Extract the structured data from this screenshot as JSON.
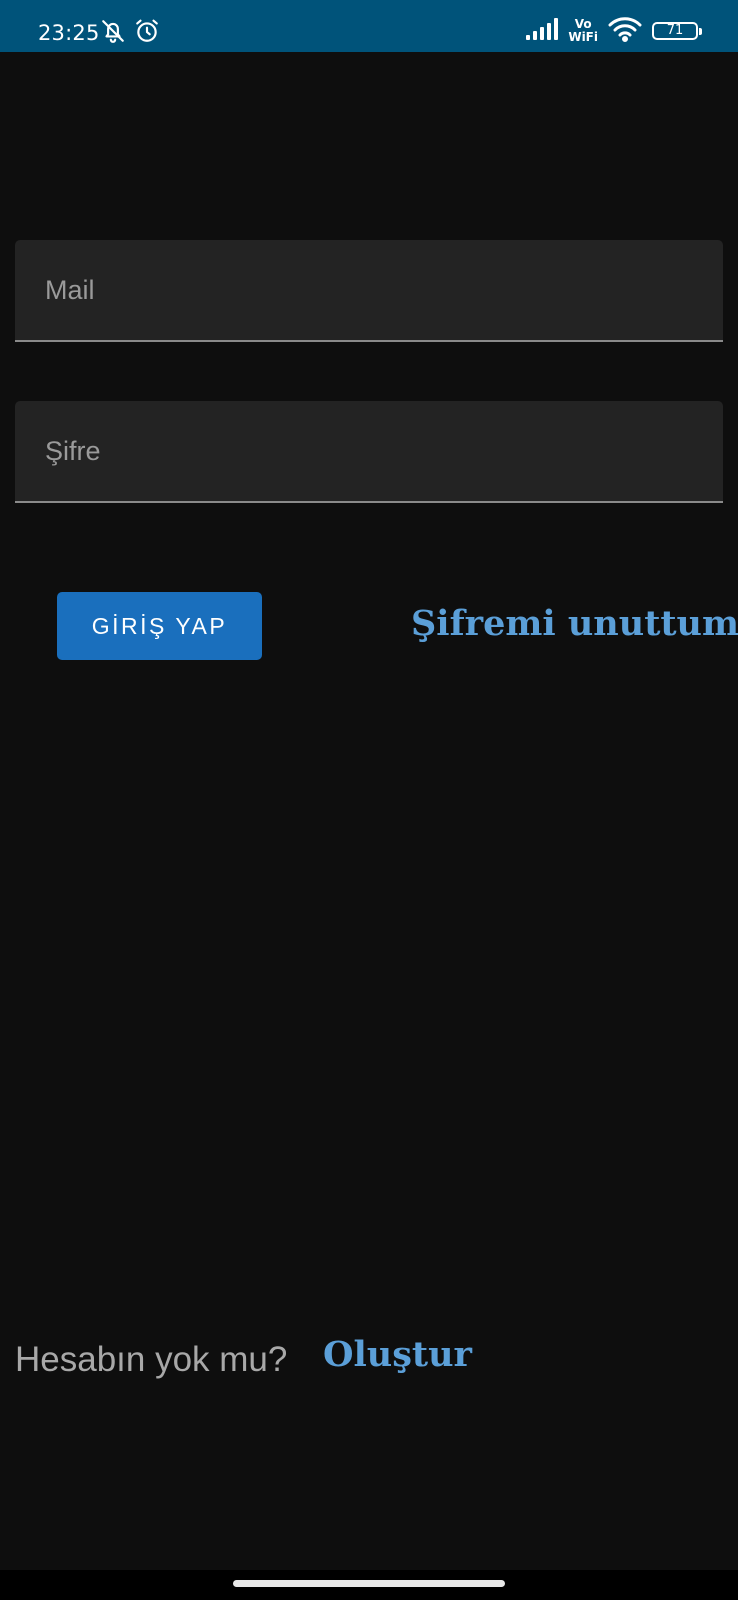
{
  "status_bar": {
    "time": "23:25",
    "left_icons": [
      "bell-off-icon",
      "alarm-icon"
    ],
    "network_label_top": "Vo",
    "network_label_bottom": "WiFi",
    "battery_level": "71",
    "background_color": "#00537a"
  },
  "login_form": {
    "mail_placeholder": "Mail",
    "mail_value": "",
    "password_placeholder": "Şifre",
    "password_value": "",
    "login_button_label": "GİRİŞ YAP",
    "forgot_password_label": "Şifremi unuttum"
  },
  "signup": {
    "prompt": "Hesabın yok mu?",
    "link_label": "Oluştur"
  },
  "colors": {
    "background": "#0e0e0e",
    "field_background": "#232323",
    "accent_button": "#1a6fbd",
    "link": "#5b9fd8"
  }
}
